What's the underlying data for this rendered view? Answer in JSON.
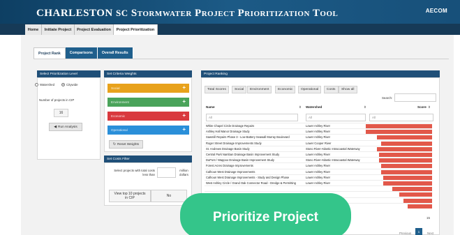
{
  "header": {
    "title_main": "Charleston",
    "title_sc": "SC",
    "title_rest": "Stormwater Project Prioritization Tool",
    "logo": "AECOM"
  },
  "nav": {
    "tabs": [
      {
        "label": "Home"
      },
      {
        "label": "Initiate Project"
      },
      {
        "label": "Project Evaluation"
      },
      {
        "label": "Project Prioritization"
      }
    ]
  },
  "subtabs": [
    {
      "label": "Project Rank"
    },
    {
      "label": "Comparisons"
    },
    {
      "label": "Overall Results"
    }
  ],
  "left_panel": {
    "title": "Select Prioritization Level",
    "opt1": "Watershed",
    "opt2": "Citywide",
    "cip_label": "Number of projects in CIP",
    "cip_value": "16",
    "run_label": "Run Analysis"
  },
  "weights_panel": {
    "title": "Set Criteria Weights",
    "bars": [
      {
        "label": "Social",
        "color": "#e8a21c"
      },
      {
        "label": "Environment",
        "color": "#4aa35a"
      },
      {
        "label": "Economic",
        "color": "#d9393e"
      },
      {
        "label": "Operational",
        "color": "#2a8fd9"
      }
    ],
    "reset_label": "Reset Weights"
  },
  "cost_panel": {
    "title": "Set Costs Filter",
    "select_label": "Select projects with total costs less than",
    "unit": "million dollars",
    "top10_label": "View top 10 projects in CIP",
    "top10_value": "No"
  },
  "ranking": {
    "title": "Project Ranking",
    "filters": [
      "Total Scores",
      "Social",
      "Environment",
      "Economic",
      "Operational",
      "Costs",
      "Show all"
    ],
    "search_label": "Search:",
    "col_name": "Name",
    "col_watershed": "Watershed",
    "col_score": "Score",
    "ph_name": "All",
    "ph_watershed": "All",
    "ph_score": "All",
    "rows": [
      {
        "name": "White Chapel Circle Drainage Repairs",
        "watershed": "Lower Ashley River",
        "score": 0.3
      },
      {
        "name": "Ashley Hall Manor Drainage Study",
        "watershed": "Lower Ashley River",
        "score": 0.3
      },
      {
        "name": "Sawmill Repairs Phase 3 - Low Battery Seawall Murray Boulevard",
        "watershed": "Lower Ashley River",
        "score": 0.25
      },
      {
        "name": "Roger Street Drainage Improvements Study",
        "watershed": "Lower Cooper River",
        "score": 0.23
      },
      {
        "name": "St. Andrews Drainage Basin Study",
        "watershed": "Stono River-Atlantic Intracoastal Waterway",
        "score": 0.25
      },
      {
        "name": "Central Park Namban Drainage Basin Improvement Study",
        "watershed": "Lower Ashley River",
        "score": 0.24
      },
      {
        "name": "DuPont / Wappoo Drainage Basin Improvement Study",
        "watershed": "Stono River-Atlantic Intracoastal Waterway",
        "score": 0.24
      },
      {
        "name": "Forest Acres Drainage Improvements",
        "watershed": "Lower Ashley River",
        "score": 0.23
      },
      {
        "name": "Calhoun West Drainage Improvements",
        "watershed": "Lower Ashley River",
        "score": 0.23
      },
      {
        "name": "Calhoun West Drainage Improvements - Study and Design Phase",
        "watershed": "Lower Ashley River",
        "score": 0.22
      },
      {
        "name": "West Ashley Circle / Grand Oak Connector Road - Dredge & Permitting",
        "watershed": "Lower Ashley River",
        "score": 0.22
      },
      {
        "name": "",
        "watershed": "",
        "score": 0.18
      },
      {
        "name": "",
        "watershed": "",
        "score": 0.15
      },
      {
        "name": "",
        "watershed": "",
        "score": 0.13
      },
      {
        "name": "",
        "watershed": "",
        "score": 0.11
      }
    ],
    "count": "15",
    "pager": {
      "prev": "Previous",
      "page": "1",
      "next": "Next"
    }
  },
  "overlay_button": "Prioritize Project"
}
